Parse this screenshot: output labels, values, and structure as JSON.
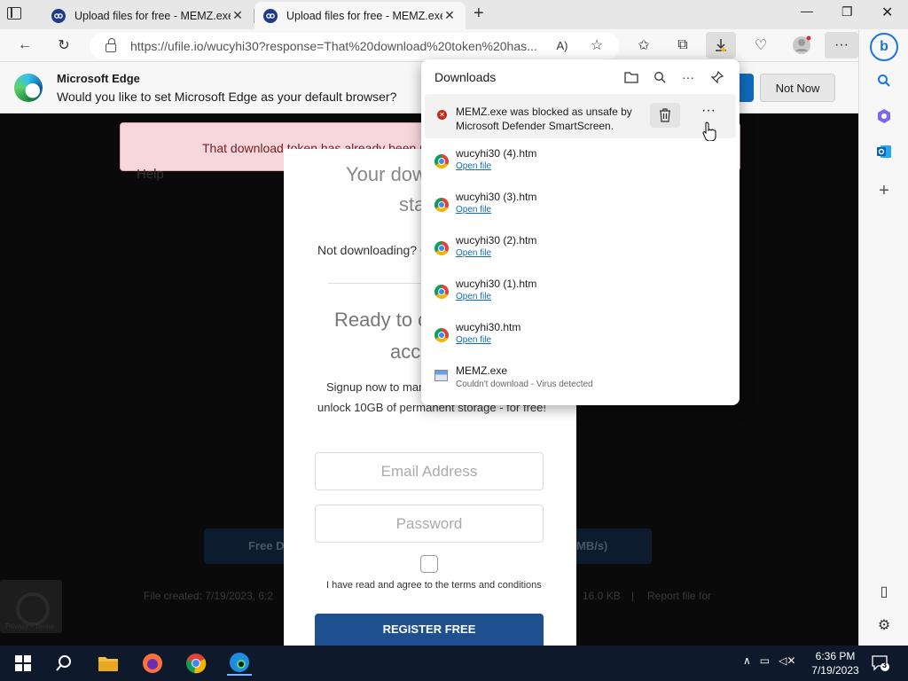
{
  "tabs": [
    {
      "title": "Upload files for free - MEMZ.exe",
      "close": "✕"
    },
    {
      "title": "Upload files for free - MEMZ.exe",
      "close": "✕"
    }
  ],
  "new_tab": "+",
  "window": {
    "minimize": "—",
    "restore": "❐",
    "close": "✕"
  },
  "toolbar": {
    "url": "https://ufile.io/wucyhi30?response=That%20download%20token%20has..."
  },
  "infobar": {
    "title": "Microsoft Edge",
    "message": "Would you like to set Microsoft Edge as your default browser?",
    "not_now": "Not Now"
  },
  "page": {
    "alert": "That download token has already been use",
    "help": "Help",
    "your_download": "Your dow",
    "starting": "sta",
    "not_downloading": "Not downloading? C",
    "ready": "Ready to c",
    "account": "acc",
    "signup_line1": "Signup now to man",
    "signup_line2": "unlock 10GB of permanent storage - for free!",
    "email_placeholder": "Email Address",
    "password_placeholder": "Password",
    "terms": "I have read and agree to the terms and conditions",
    "register": "REGISTER FREE",
    "free_dl_left": "Free D",
    "free_dl_right": "MB/s)",
    "file_created": "File created: 7/19/2023, 6:2",
    "file_size": "16.0 KB",
    "meta_sep": "|",
    "report": "Report file for",
    "recaptcha_footer": "Privacy - Terms"
  },
  "downloads": {
    "title": "Downloads",
    "blocked_message": "MEMZ.exe was blocked as unsafe by Microsoft Defender SmartScreen.",
    "items": [
      {
        "name": "wucyhi30 (4).htm",
        "action": "Open file"
      },
      {
        "name": "wucyhi30 (3).htm",
        "action": "Open file"
      },
      {
        "name": "wucyhi30 (2).htm",
        "action": "Open file"
      },
      {
        "name": "wucyhi30 (1).htm",
        "action": "Open file"
      },
      {
        "name": "wucyhi30.htm",
        "action": "Open file"
      }
    ],
    "failed": {
      "name": "MEMZ.exe",
      "status": "Couldn't download - Virus detected"
    },
    "more": "···"
  },
  "taskbar": {
    "time": "6:36 PM",
    "date": "7/19/2023",
    "notifications": "3"
  }
}
